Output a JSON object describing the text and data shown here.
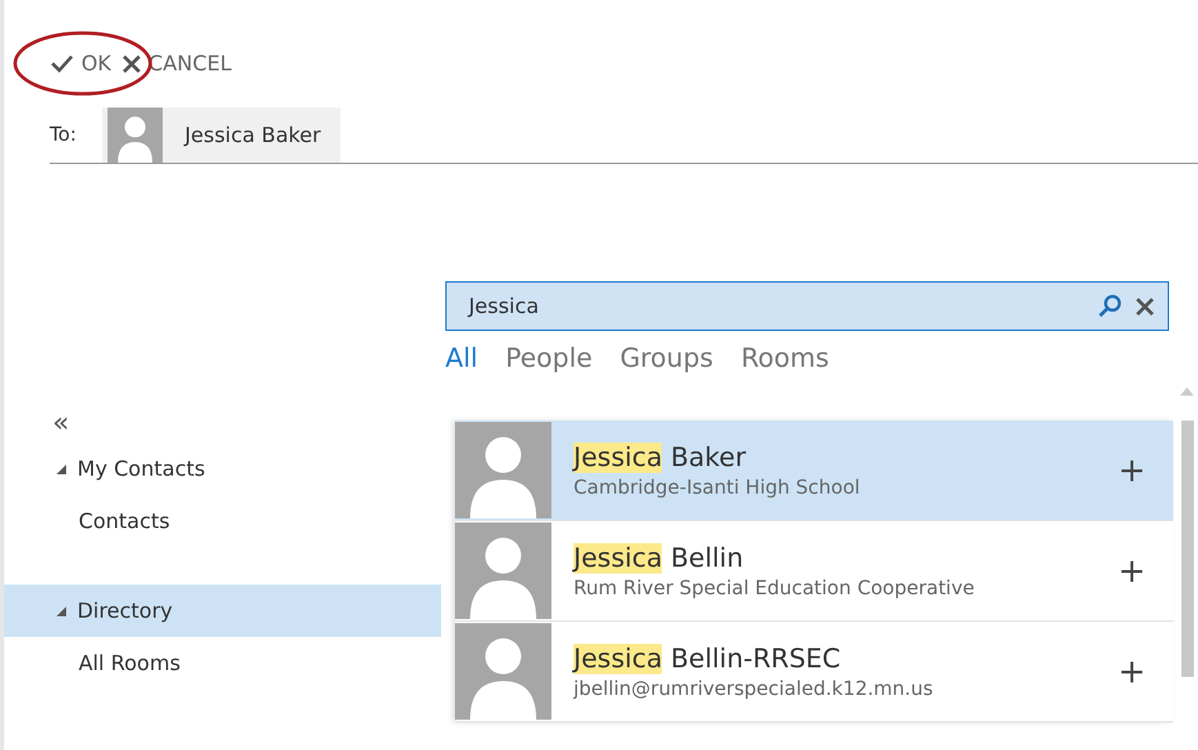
{
  "toolbar": {
    "ok": "OK",
    "ok_circled": true,
    "cancel": "CANCEL"
  },
  "to": {
    "label": "To:",
    "recipients": [
      {
        "name": "Jessica Baker"
      }
    ]
  },
  "search": {
    "value": "Jessica"
  },
  "filters": [
    {
      "label": "All",
      "selected": true
    },
    {
      "label": "People",
      "selected": false
    },
    {
      "label": "Groups",
      "selected": false
    },
    {
      "label": "Rooms",
      "selected": false
    }
  ],
  "collapse": "«",
  "sidebar": [
    {
      "label": "My Contacts",
      "selected": false,
      "children": [
        {
          "label": "Contacts",
          "selected": false
        }
      ]
    },
    {
      "label": "Directory",
      "selected": true,
      "children": [
        {
          "label": "All Rooms",
          "selected": false
        }
      ]
    }
  ],
  "results": [
    {
      "match": "Jessica",
      "rest": " Baker",
      "detail": "Cambridge-Isanti High School",
      "selected": true,
      "add": "+"
    },
    {
      "match": "Jessica",
      "rest": " Bellin",
      "detail": "Rum River Special Education Cooperative",
      "selected": false,
      "add": "+"
    },
    {
      "match": "Jessica",
      "rest": " Bellin-RRSEC",
      "detail": "jbellin@rumriverspecialed.k12.mn.us",
      "selected": false,
      "add": "+"
    }
  ]
}
